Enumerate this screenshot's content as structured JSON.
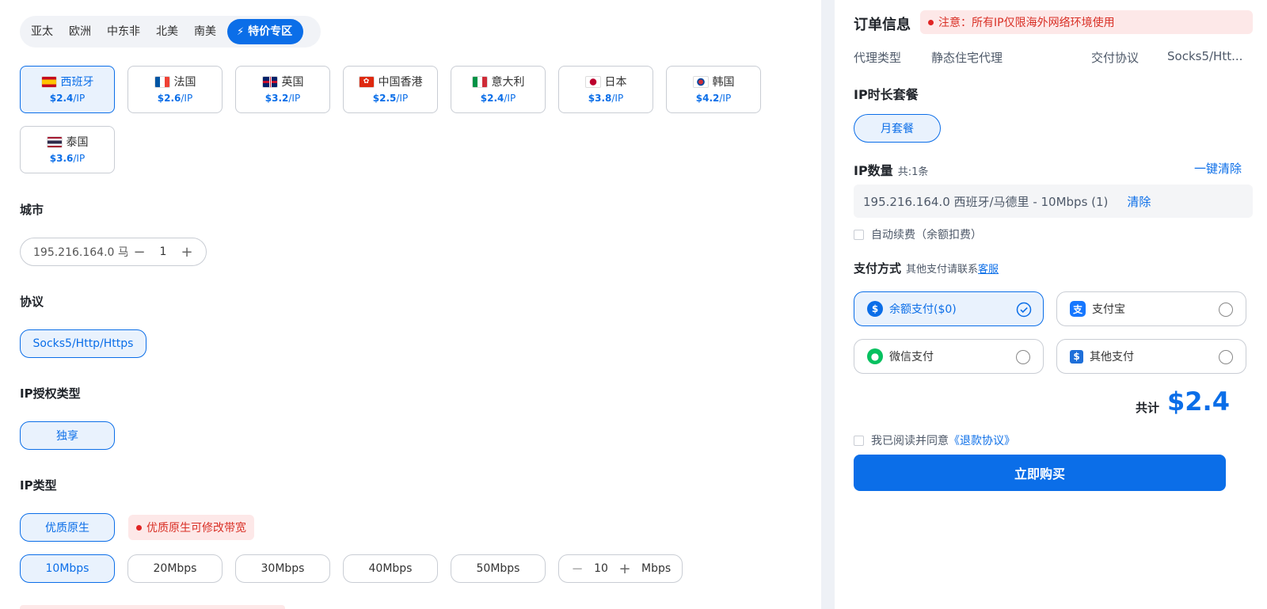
{
  "regions": [
    "亚太",
    "欧洲",
    "中东非",
    "北美",
    "南美"
  ],
  "special_tab": "特价专区",
  "countries": [
    {
      "name": "西班牙",
      "price": "$2.4",
      "unit": "/IP",
      "flag": "spain-flag-icon"
    },
    {
      "name": "法国",
      "price": "$2.6",
      "unit": "/IP",
      "flag": "france-flag-icon"
    },
    {
      "name": "英国",
      "price": "$3.2",
      "unit": "/IP",
      "flag": "uk-flag-icon"
    },
    {
      "name": "中国香港",
      "price": "$2.5",
      "unit": "/IP",
      "flag": "hongkong-flag-icon"
    },
    {
      "name": "意大利",
      "price": "$2.4",
      "unit": "/IP",
      "flag": "italy-flag-icon"
    },
    {
      "name": "日本",
      "price": "$3.8",
      "unit": "/IP",
      "flag": "japan-flag-icon"
    },
    {
      "name": "韩国",
      "price": "$4.2",
      "unit": "/IP",
      "flag": "korea-flag-icon"
    },
    {
      "name": "泰国",
      "price": "$3.6",
      "unit": "/IP",
      "flag": "thailand-flag-icon"
    }
  ],
  "city": {
    "title": "城市",
    "value": "195.216.164.0 马...",
    "qty": "1",
    "minus": "−",
    "plus": "+"
  },
  "protocol": {
    "title": "协议",
    "value": "Socks5/Http/Https"
  },
  "auth": {
    "title": "IP授权类型",
    "value": "独享"
  },
  "iptype": {
    "title": "IP类型",
    "value": "优质原生",
    "warning": "优质原生可修改带宽"
  },
  "bandwidth": {
    "options": [
      "10Mbps",
      "20Mbps",
      "30Mbps",
      "40Mbps",
      "50Mbps"
    ],
    "custom_value": "10",
    "unit": "Mbps",
    "minus": "−",
    "plus": "+"
  },
  "order": {
    "title": "订单信息",
    "notice": "注意：所有IP仅限海外网络环境使用",
    "proxy_type_label": "代理类型",
    "proxy_type_value": "静态住宅代理",
    "protocol_label": "交付协议",
    "protocol_value": "Socks5/Htt...",
    "duration_title": "IP时长套餐",
    "duration_value": "月套餐",
    "qty_title": "IP数量",
    "qty_note": "共:1条",
    "clear_all": "一键清除",
    "ip_line": "195.216.164.0 西班牙/马德里 - 10Mbps (1)",
    "ip_clear": "清除",
    "auto_renew": "自动续费（余额扣费）",
    "pay_title": "支付方式",
    "pay_note": "其他支付请联系",
    "pay_link": "客服",
    "pay_methods": [
      {
        "label": "余额支付($0)",
        "icon": "dollar-icon",
        "color": "#0b6ee8"
      },
      {
        "label": "支付宝",
        "icon": "alipay-icon",
        "color": "#1677ff"
      },
      {
        "label": "微信支付",
        "icon": "wechat-icon",
        "color": "#07c160"
      },
      {
        "label": "其他支付",
        "icon": "wallet-icon",
        "color": "#1e6fd9"
      }
    ],
    "total_label": "共计",
    "total_value": "$2.4",
    "agree_prefix": "我已阅读并同意",
    "agree_link": "《退款协议》",
    "buy": "立即购买"
  },
  "colors": {
    "accent": "#0b6ee8",
    "warning": "#d93026",
    "warning_bg": "#fde8e8"
  }
}
